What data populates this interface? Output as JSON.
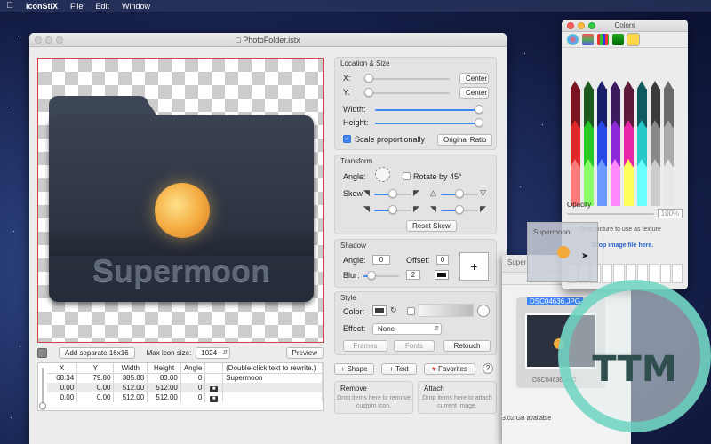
{
  "menubar": {
    "app": "iconStiX",
    "items": [
      "File",
      "Edit",
      "Window"
    ]
  },
  "main_window": {
    "title": "PhotoFolder.istx"
  },
  "canvas": {
    "folder_text": "Supermoon"
  },
  "bottom_bar": {
    "add_separate_label": "Add separate 16x16",
    "max_icon_label": "Max icon size:",
    "max_icon_value": "1024",
    "preview_label": "Preview"
  },
  "layers_table": {
    "headers": [
      "X",
      "Y",
      "Width",
      "Height",
      "Angle",
      "",
      "(Double-click text to rewrite.)"
    ],
    "rows": [
      {
        "x": "68.34",
        "y": "79.80",
        "w": "385.88",
        "h": "83.00",
        "a": "0",
        "text": "Supermoon"
      },
      {
        "x": "0.00",
        "y": "0.00",
        "w": "512.00",
        "h": "512.00",
        "a": "0",
        "text": ""
      },
      {
        "x": "0.00",
        "y": "0.00",
        "w": "512.00",
        "h": "512.00",
        "a": "0",
        "text": ""
      }
    ]
  },
  "location": {
    "title": "Location & Size",
    "x_label": "X:",
    "y_label": "Y:",
    "width_label": "Width:",
    "height_label": "Height:",
    "center_label": "Center",
    "scale_label": "Scale proportionally",
    "original_ratio_label": "Original Ratio",
    "x_value": 0,
    "y_value": 0,
    "width_value": 1,
    "height_value": 1
  },
  "transform": {
    "title": "Transform",
    "angle_label": "Angle:",
    "rotate45_label": "Rotate by 45°",
    "skew_label": "Skew",
    "reset_skew_label": "Reset Skew"
  },
  "shadow": {
    "title": "Shadow",
    "angle_label": "Angle:",
    "angle_value": "0",
    "offset_label": "Offset:",
    "offset_value": "0",
    "blur_label": "Blur:",
    "blur_value": "2",
    "add_label": "+"
  },
  "style": {
    "title": "Style",
    "color_label": "Color:",
    "effect_label": "Effect:",
    "effect_value": "None",
    "frames_label": "Frames",
    "fonts_label": "Fonts",
    "retouch_label": "Retouch"
  },
  "actions": {
    "shape_label": "+ Shape",
    "text_label": "+ Text",
    "favorites_label": "Favorites",
    "help_label": "?"
  },
  "remove_box": {
    "title": "Remove",
    "desc": "Drop items here to remove custom icon."
  },
  "attach_box": {
    "title": "Attach",
    "desc": "Drop items here to attach current image."
  },
  "colors_window": {
    "title": "Colors",
    "opacity_label": "Opacity",
    "opacity_value": "100%",
    "texture_label": "Drop picture to use as texture",
    "drop_label": "Drop image file here."
  },
  "behind_window": {
    "title": "Super",
    "file1": "DSC04636.JPG",
    "file2": "DSC04636.JPG",
    "status": "3.02 GB available"
  },
  "drag_ghost": {
    "label": "Supermoon"
  },
  "watermark": {
    "text": "TTM"
  },
  "colors": {
    "accent": "#3e86f4",
    "moon": "#f3a93c",
    "folder": "#2f3644"
  }
}
